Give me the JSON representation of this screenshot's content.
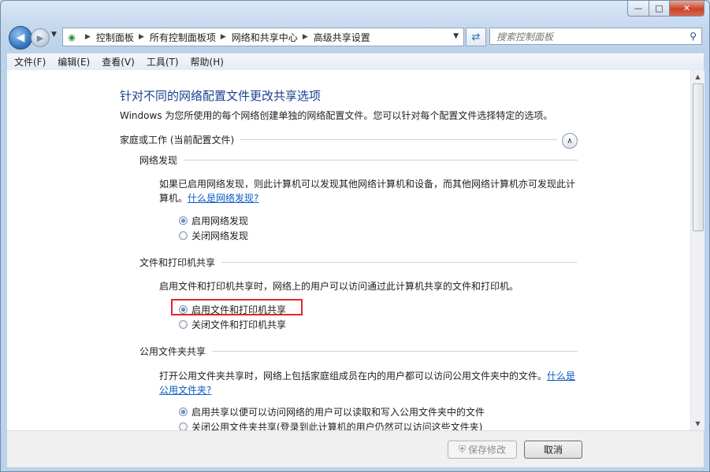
{
  "window": {
    "caption_buttons": {
      "minimize": "—",
      "maximize": "□",
      "close": "✕"
    }
  },
  "navigation": {
    "breadcrumbs": [
      "控制面板",
      "所有控制面板项",
      "网络和共享中心",
      "高级共享设置"
    ],
    "search_placeholder": "搜索控制面板"
  },
  "menu": {
    "items": [
      "文件(F)",
      "编辑(E)",
      "查看(V)",
      "工具(T)",
      "帮助(H)"
    ]
  },
  "content": {
    "title": "针对不同的网络配置文件更改共享选项",
    "subtitle": "Windows 为您所使用的每个网络创建单独的网络配置文件。您可以针对每个配置文件选择特定的选项。",
    "profile_header": "家庭或工作 (当前配置文件)",
    "network_discovery": {
      "header": "网络发现",
      "description": "如果已启用网络发现，则此计算机可以发现其他网络计算机和设备，而其他网络计算机亦可发现此计算机。",
      "link": "什么是网络发现?",
      "options": [
        "启用网络发现",
        "关闭网络发现"
      ],
      "selected_index": 0
    },
    "file_printer_sharing": {
      "header": "文件和打印机共享",
      "description": "启用文件和打印机共享时，网络上的用户可以访问通过此计算机共享的文件和打印机。",
      "options": [
        "启用文件和打印机共享",
        "关闭文件和打印机共享"
      ],
      "selected_index": 0
    },
    "public_folder_sharing": {
      "header": "公用文件夹共享",
      "description": "打开公用文件夹共享时，网络上包括家庭组成员在内的用户都可以访问公用文件夹中的文件。",
      "link": "什么是公用文件夹?",
      "options": [
        "启用共享以便可以访问网络的用户可以读取和写入公用文件夹中的文件",
        "关闭公用文件夹共享(登录到此计算机的用户仍然可以访问这些文件夹)"
      ],
      "selected_index": 0
    }
  },
  "footer": {
    "save_label": "保存修改",
    "cancel_label": "取消"
  },
  "colors": {
    "title_blue": "#1b3f91",
    "link_blue": "#0a5bc4",
    "highlight_red": "#e0262a"
  },
  "icons": [
    "back-arrow-icon",
    "forward-arrow-icon",
    "network-icon",
    "refresh-icon",
    "search-icon",
    "collapse-chevron-icon",
    "shield-icon"
  ]
}
